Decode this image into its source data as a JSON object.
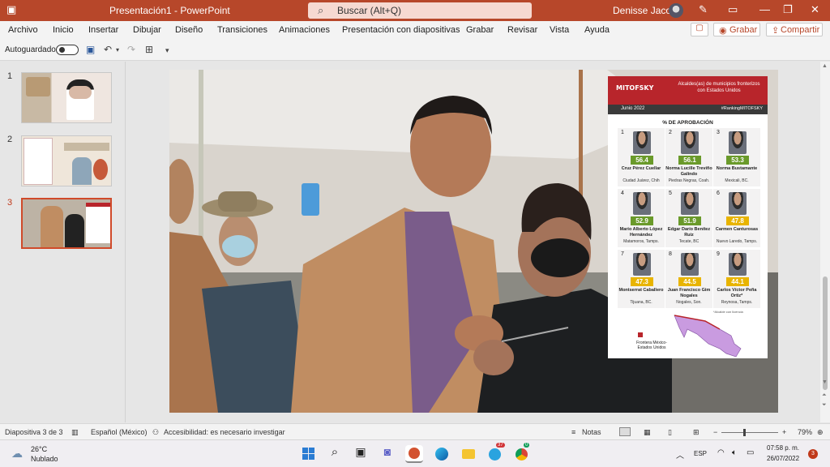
{
  "window": {
    "doc_title": "Presentación1  -  PowerPoint",
    "search_placeholder": "Buscar (Alt+Q)",
    "user_name": "Denisse Jacobo"
  },
  "menu": [
    "Archivo",
    "Inicio",
    "Insertar",
    "Dibujar",
    "Diseño",
    "Transiciones",
    "Animaciones",
    "Presentación con diapositivas",
    "Grabar",
    "Revisar",
    "Vista",
    "Ayuda"
  ],
  "ribbon_right": {
    "grabar": "Grabar",
    "compartir": "Compartir"
  },
  "qat": {
    "autosave_label": "Autoguardado"
  },
  "thumbnails": [
    {
      "num": "1",
      "selected": false
    },
    {
      "num": "2",
      "selected": false
    },
    {
      "num": "3",
      "selected": true
    }
  ],
  "ranking": {
    "brand": "MITOFSKY",
    "date": "Junio 2022",
    "headline": "Alcaldes(as) de municipios fronterizos con Estados Unidos",
    "hashtag": "#RankingMITOFSKY",
    "section": "% DE APROBACIÓN",
    "entries": [
      {
        "rank": "1",
        "score": "56.4",
        "name": "Cruz Pérez Cuellar",
        "place": "Ciudad Juárez, Chih",
        "color": "#6a9a2a"
      },
      {
        "rank": "2",
        "score": "56.1",
        "name": "Norma Lucille Treviño Galindo",
        "place": "Piedras Negras, Coah.",
        "color": "#6a9a2a"
      },
      {
        "rank": "3",
        "score": "53.3",
        "name": "Norma Bustamante",
        "place": "Mexicali, BC.",
        "color": "#6a9a2a"
      },
      {
        "rank": "4",
        "score": "52.9",
        "name": "Mario Alberto López Hernández",
        "place": "Matamoros, Tamps.",
        "color": "#6a9a2a"
      },
      {
        "rank": "5",
        "score": "51.9",
        "name": "Edgar Darío Benítez Ruiz",
        "place": "Tecate, BC",
        "color": "#6a9a2a"
      },
      {
        "rank": "6",
        "score": "47.8",
        "name": "Carmen Canturosas",
        "place": "Nuevo Laredo, Tamps.",
        "color": "#e8b400"
      },
      {
        "rank": "7",
        "score": "47.3",
        "name": "Montserrat Caballero",
        "place": "Tijuana, BC.",
        "color": "#e8b400"
      },
      {
        "rank": "8",
        "score": "44.5",
        "name": "Juan Francisco Gim Nogales",
        "place": "Nogales, Son.",
        "color": "#e8b400"
      },
      {
        "rank": "9",
        "score": "44.1",
        "name": "Carlos Víctor Peña Ortiz*",
        "place": "Reynosa, Tamps.",
        "color": "#e8b400"
      }
    ],
    "footnote": "*Alcalde con licencia",
    "legend": "Frontera México-Estados Unidos"
  },
  "status": {
    "slide": "Diapositiva 3 de 3",
    "lang": "Español (México)",
    "access": "Accesibilidad: es necesario investigar",
    "notes": "Notas",
    "zoom": "79%"
  },
  "taskbar": {
    "temp": "26°C",
    "weather": "Nublado",
    "lang": "ESP",
    "time": "07:58 p. m.",
    "date": "26/07/2022",
    "notif": "3",
    "badge_red": "37",
    "badge_green": "0"
  }
}
